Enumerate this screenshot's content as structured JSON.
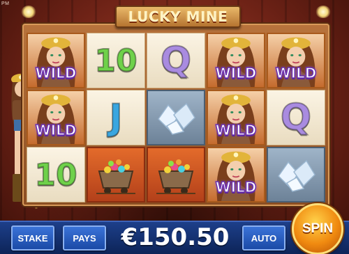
{
  "corner_label": "PM",
  "title": "LUCKY MINE",
  "reels": [
    [
      {
        "kind": "wild",
        "label": "WILD"
      },
      {
        "kind": "ten",
        "label": "10"
      },
      {
        "kind": "q",
        "label": "Q"
      },
      {
        "kind": "wild",
        "label": "WILD"
      },
      {
        "kind": "wild",
        "label": "WILD"
      }
    ],
    [
      {
        "kind": "wild",
        "label": "WILD"
      },
      {
        "kind": "j",
        "label": "J"
      },
      {
        "kind": "gems",
        "label": ""
      },
      {
        "kind": "wild",
        "label": "WILD"
      },
      {
        "kind": "q",
        "label": "Q"
      }
    ],
    [
      {
        "kind": "ten",
        "label": "10"
      },
      {
        "kind": "cart",
        "label": ""
      },
      {
        "kind": "cart",
        "label": ""
      },
      {
        "kind": "wild",
        "label": "WILD"
      },
      {
        "kind": "gems",
        "label": ""
      }
    ]
  ],
  "controls": {
    "stake_label": "STAKE",
    "pays_label": "PAYS",
    "balance": "€150.50",
    "auto_label": "AUTO",
    "spin_label": "SPIN"
  },
  "colors": {
    "wild_text_outline": "#6a2fb0",
    "bar_blue": "#1d3f8a",
    "spin_orange": "#f08a10"
  }
}
